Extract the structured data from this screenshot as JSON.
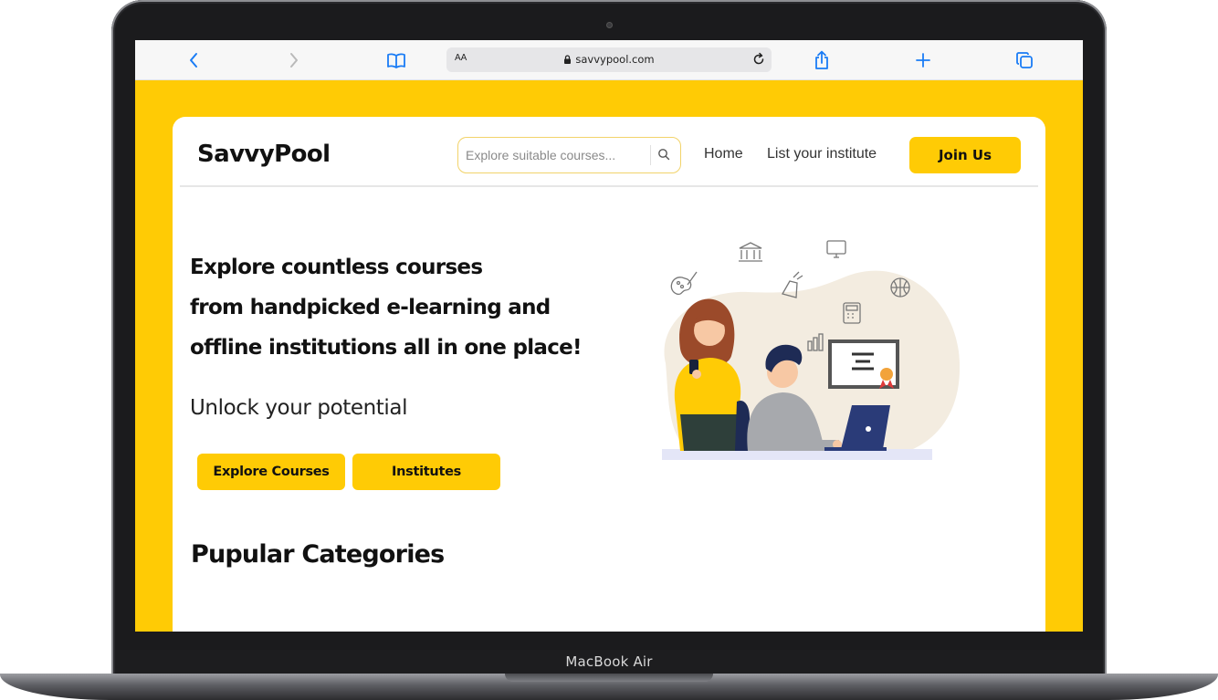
{
  "device": {
    "label": "MacBook Air"
  },
  "browser": {
    "text_size_label": "AA",
    "url": "savvypool.com",
    "icons": [
      "back-icon",
      "forward-icon",
      "bookmarks-icon",
      "lock-icon",
      "reload-icon",
      "share-icon",
      "new-tab-icon",
      "tabs-icon"
    ]
  },
  "site": {
    "logo": "SavvyPool",
    "search": {
      "placeholder": "Explore suitable courses...",
      "value": ""
    },
    "nav": {
      "home": "Home",
      "list_institute": "List your institute",
      "join": "Join Us"
    },
    "hero": {
      "lines": [
        "Explore countless courses",
        "from handpicked e-learning and",
        "offline institutions all in one place!"
      ],
      "tagline": "Unlock your potential",
      "buttons": {
        "explore": "Explore Courses",
        "institutes": "Institutes"
      }
    },
    "section_title": "Pupular Categories"
  },
  "colors": {
    "accent": "#ffcb05",
    "text": "#111111",
    "frame": "#1b1b1d"
  }
}
